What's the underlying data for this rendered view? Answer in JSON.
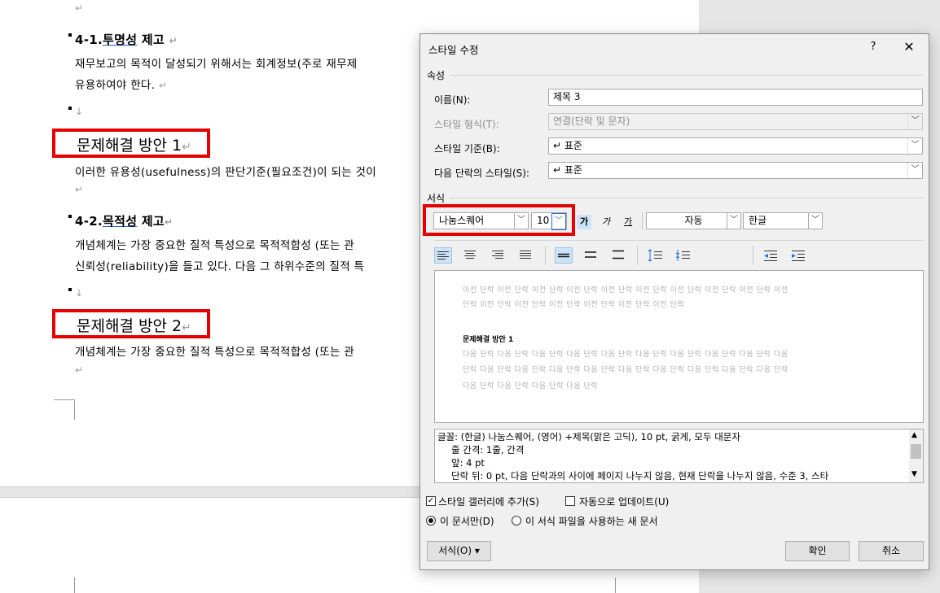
{
  "document": {
    "marks": {
      "para": "↵",
      "down": "↓"
    },
    "section1": {
      "number": "4-1.",
      "title_u": "투명성",
      "title_rest": " 제고"
    },
    "section1_line1": "재무보고의 목적이 달성되기 위해서는 회계정보(주로 재무제",
    "section1_line2": "유용하여야 한다.",
    "heading_a": "문제해결 방안 1",
    "para_a": "이러한 유용성(usefulness)의 판단기준(필요조건)이 되는 것이",
    "section2": {
      "number": "4-2.",
      "title_u": "목적성",
      "title_rest": " 제고"
    },
    "section2_line1": "개념체계는 가장 중요한 질적 특성으로 목적적합성 (또는 관",
    "section2_line2": "신뢰성(reliability)을 들고 있다. 다음 그 하위수준의 질적 특",
    "heading_b": "문제해결 방안 2",
    "para_b": "개념체계는 가장 중요한 질적 특성으로 목적적합성 (또는 관"
  },
  "dialog": {
    "title": "스타일 수정",
    "help": "?",
    "close": "✕",
    "properties_label": "속성",
    "name_label": "이름(N):",
    "name_value": "제목 3",
    "style_type_label": "스타일 형식(T):",
    "style_type_value": "연결(단락 및 문자)",
    "based_on_label": "스타일 기준(B):",
    "based_on_value": "↵ 표준",
    "next_style_label": "다음 단락의 스타일(S):",
    "next_style_value": "↵ 표준",
    "format_label": "서식",
    "font_name": "나눔스퀘어",
    "font_size": "10",
    "bold_glyph": "가",
    "italic_glyph": "가",
    "underline_glyph": "가",
    "color_value": "자동",
    "script_value": "한글",
    "preview": {
      "prev_line1": "이전 단락 이전 단락 이전 단락 이전 단락 이전 단락 이전 단락 이전 단락 이전 단락 이전 단락 이전",
      "prev_line2": "단락 이전 단락 이전 단락 이전 단락 이전 단락 이전 단락 이전 단락",
      "sample": "문제해결 방안 1",
      "next_line1": "다음 단락 다음 단락 다음 단락 다음 단락 다음 단락 다음 단락 다음 단락 다음 단락 다음 단락 다음",
      "next_line2": "단락 다음 단락 다음 단락 다음 단락 다음 단락 다음 단락 다음 단락 다음 단락 다음 단락 다음 단락",
      "next_line3": "다음 단락 다음 단락 다음 단락 다음 단락"
    },
    "description": {
      "line1": "글꼴: (한글) 나눔스퀘어, (영어) +제목(맑은 고딕), 10 pt, 굵게, 모두 대문자",
      "line2": "줄 간격: 1줄, 간격",
      "line3": "앞: 4 pt",
      "line4": "단락 뒤: 0 pt, 다음 단락과의 사이에 페이지 나누지 않음, 현재 단락을 나누지 않음, 수준 3, 스타"
    },
    "add_to_gallery": "스타일 갤러리에 추가(S)",
    "auto_update": "자동으로 업데이트(U)",
    "only_this_doc": "이 문서만(D)",
    "new_docs_template": "이 서식 파일을 사용하는 새 문서",
    "format_button": "서식(O) ▾",
    "ok": "확인",
    "cancel": "취소"
  }
}
